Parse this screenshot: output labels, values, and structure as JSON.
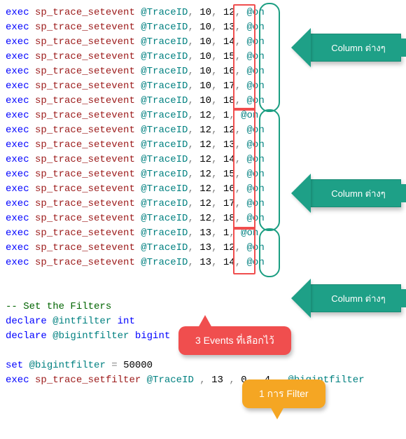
{
  "kw": {
    "exec": "exec",
    "declare": "declare",
    "set": "set",
    "int": "int",
    "bigint": "bigint"
  },
  "proc": {
    "setevent": "sp_trace_setevent",
    "setfilter": "sp_trace_setfilter"
  },
  "var": {
    "traceid": "@TraceID",
    "on": "@on",
    "intfilter": "@intfilter",
    "bigintfilter": "@bigintfilter"
  },
  "sep": {
    "comma": ",",
    "eq": " = "
  },
  "comment": "-- Set the Filters",
  "num": {
    "fifty_k": "50000",
    "thirteen": "13",
    "zero": "0",
    "four": "4"
  },
  "events": [
    {
      "ev": "10",
      "col": "12"
    },
    {
      "ev": "10",
      "col": "13"
    },
    {
      "ev": "10",
      "col": "14"
    },
    {
      "ev": "10",
      "col": "15"
    },
    {
      "ev": "10",
      "col": "16"
    },
    {
      "ev": "10",
      "col": "17"
    },
    {
      "ev": "10",
      "col": "18"
    },
    {
      "ev": "12",
      "col": "1"
    },
    {
      "ev": "12",
      "col": "12"
    },
    {
      "ev": "12",
      "col": "13"
    },
    {
      "ev": "12",
      "col": "14"
    },
    {
      "ev": "12",
      "col": "15"
    },
    {
      "ev": "12",
      "col": "16"
    },
    {
      "ev": "12",
      "col": "17"
    },
    {
      "ev": "12",
      "col": "18"
    },
    {
      "ev": "13",
      "col": "1"
    },
    {
      "ev": "13",
      "col": "12"
    },
    {
      "ev": "13",
      "col": "14"
    }
  ],
  "labels": {
    "arrow_col": "Column ต่างๆ",
    "callout_events": "3 Events ที่เลือกไว้",
    "callout_filter": "1 การ Filter"
  }
}
